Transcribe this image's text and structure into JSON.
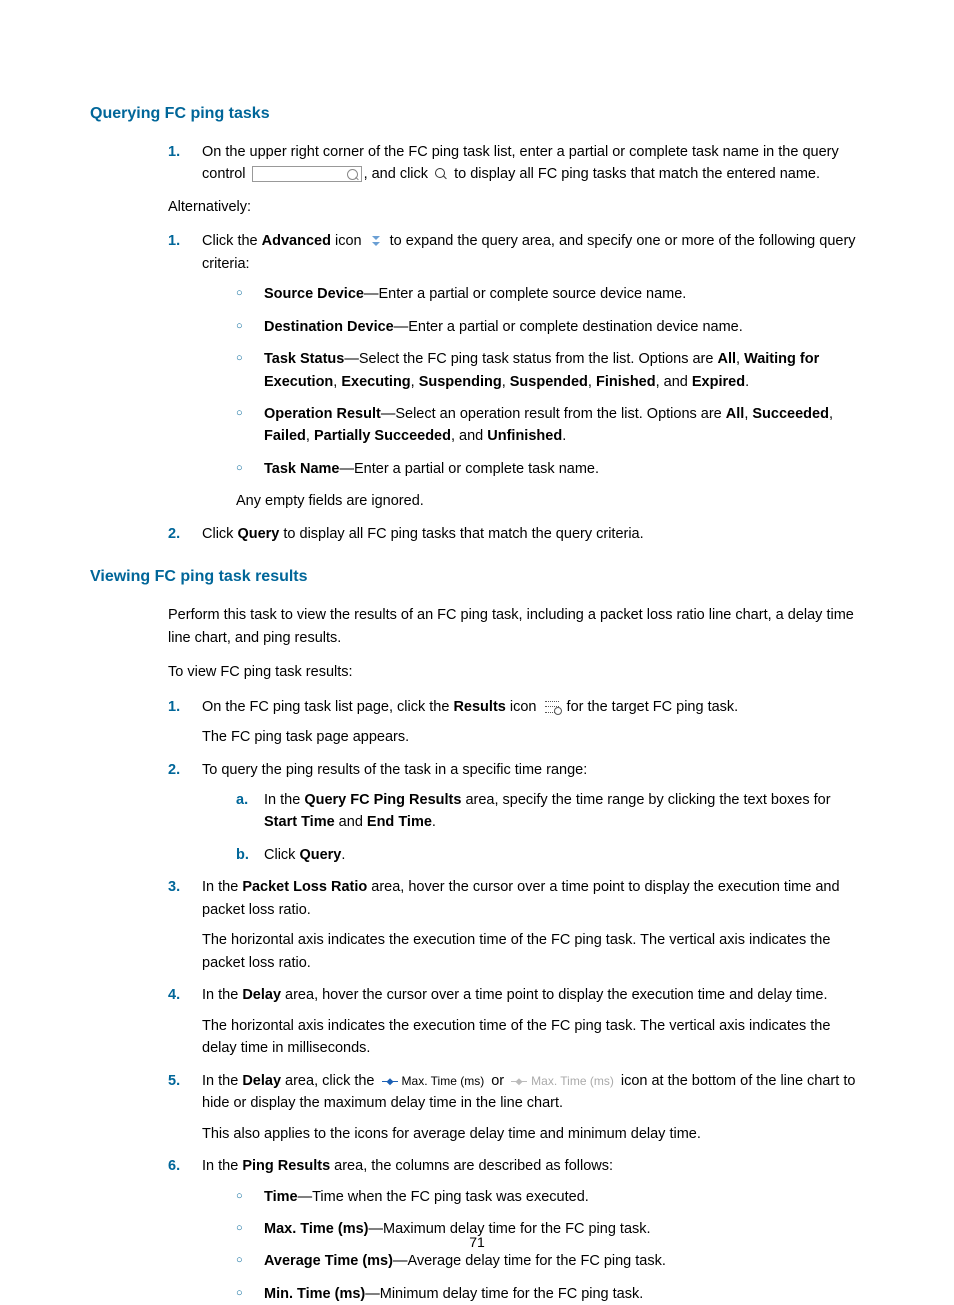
{
  "page_number": "71",
  "sections": {
    "querying": {
      "heading": "Querying FC ping tasks",
      "step1_pre": "On the upper right corner of the FC ping task list, enter a partial or complete task name in the query control ",
      "step1_mid": ", and click ",
      "step1_post": " to display all FC ping tasks that match the entered name.",
      "alt": "Alternatively:",
      "adv_pre": "Click the ",
      "adv_bold": "Advanced",
      "adv_mid": " icon ",
      "adv_post": " to expand the query area, and specify one or more of the following query criteria:",
      "criteria": {
        "src_b": "Source Device",
        "src_t": "—Enter a partial or complete source device name.",
        "dst_b": "Destination Device",
        "dst_t": "—Enter a partial or complete destination device name.",
        "status_b": "Task Status",
        "status_t1": "—Select the FC ping task status from the list. Options are ",
        "status_all": "All",
        "status_c1": ", ",
        "status_wfe": "Waiting for Execution",
        "status_c2": ", ",
        "status_exe": "Executing",
        "status_c3": ", ",
        "status_susing": "Suspending",
        "status_c4": ", ",
        "status_sused": "Suspended",
        "status_c5": ", ",
        "status_fin": "Finished",
        "status_c6": ", and ",
        "status_exp": "Expired",
        "status_end": ".",
        "op_b": "Operation Result",
        "op_t1": "—Select an operation result from the list. Options are ",
        "op_all": "All",
        "op_c1": ", ",
        "op_succ": "Succeeded",
        "op_c2": ", ",
        "op_fail": "Failed",
        "op_c3": ", ",
        "op_ps": "Partially Succeeded",
        "op_c4": ", and ",
        "op_unf": "Unfinished",
        "op_end": ".",
        "tn_b": "Task Name",
        "tn_t": "—Enter a partial or complete task name."
      },
      "ignored": "Any empty fields are ignored.",
      "step2_pre": "Click ",
      "step2_b": "Query",
      "step2_post": " to display all FC ping tasks that match the query criteria."
    },
    "viewing": {
      "heading": "Viewing FC ping task results",
      "intro": "Perform this task to view the results of an FC ping task, including a packet loss ratio line chart, a delay time line chart, and ping results.",
      "intro2": "To view FC ping task results:",
      "s1_pre": "On the FC ping task list page, click the ",
      "s1_b": "Results",
      "s1_mid": " icon ",
      "s1_post": " for the target FC ping task.",
      "s1_f": "The FC ping task page appears.",
      "s2": "To query the ping results of the task in a specific time range:",
      "s2a_pre": "In the ",
      "s2a_b1": "Query FC Ping Results",
      "s2a_mid": " area, specify the time range by clicking the text boxes for ",
      "s2a_b2": "Start Time",
      "s2a_and": " and ",
      "s2a_b3": "End Time",
      "s2a_end": ".",
      "s2b_pre": "Click ",
      "s2b_b": "Query",
      "s2b_end": ".",
      "s3_pre": "In the ",
      "s3_b": "Packet Loss Ratio",
      "s3_post": " area, hover the cursor over a time point to display the execution time and packet loss ratio.",
      "s3_f": "The horizontal axis indicates the execution time of the FC ping task. The vertical axis indicates the packet loss ratio.",
      "s4_pre": "In the ",
      "s4_b": "Delay",
      "s4_post": " area, hover the cursor over a time point to display the execution time and delay time.",
      "s4_f": "The horizontal axis indicates the execution time of the FC ping task. The vertical axis indicates the delay time in milliseconds.",
      "s5_pre": "In the ",
      "s5_b": "Delay",
      "s5_mid": " area, click the ",
      "s5_or": " or ",
      "s5_post": " icon at the bottom of the line chart to hide or display the maximum delay time in the line chart.",
      "s5_f": "This also applies to the icons for average delay time and minimum delay time.",
      "legend_active": "Max. Time (ms)",
      "legend_inactive": "Max. Time (ms)",
      "s6_pre": "In the ",
      "s6_b": "Ping Results",
      "s6_post": " area, the columns are described as follows:",
      "cols": {
        "time_b": "Time",
        "time_t": "—Time when the FC ping task was executed.",
        "max_b": "Max. Time (ms)",
        "max_t": "—Maximum delay time for the FC ping task.",
        "avg_b": "Average Time (ms)",
        "avg_t": "—Average delay time for the FC ping task.",
        "min_b": "Min. Time (ms)",
        "min_t": "—Minimum delay time for the FC ping task."
      }
    }
  }
}
